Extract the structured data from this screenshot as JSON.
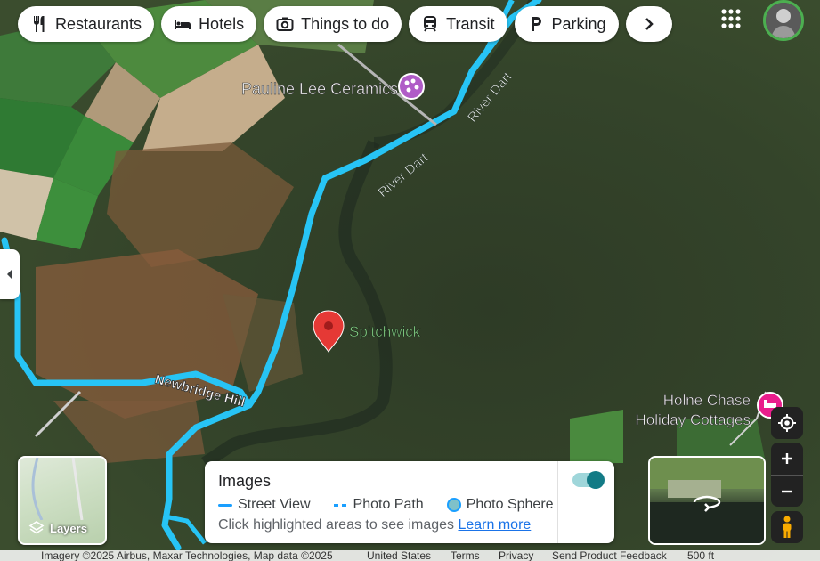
{
  "chips": [
    {
      "label": "Restaurants",
      "icon": "fork-knife-icon"
    },
    {
      "label": "Hotels",
      "icon": "bed-icon"
    },
    {
      "label": "Things to do",
      "icon": "camera-icon"
    },
    {
      "label": "Transit",
      "icon": "train-icon"
    },
    {
      "label": "Parking",
      "icon": "parking-icon"
    }
  ],
  "map": {
    "places": {
      "pauline_lee": "Pauline Lee Ceramics",
      "spitchwick": "Spitchwick",
      "holne_chase_line1": "Holne Chase",
      "holne_chase_line2": "Holiday Cottages"
    },
    "roads": {
      "river_dart_1": "River Dart",
      "river_dart_2": "River Dart",
      "newbridge_hill": "Newbridge Hill"
    }
  },
  "layers": {
    "label": "Layers"
  },
  "images_panel": {
    "title": "Images",
    "street_view": "Street View",
    "photo_path": "Photo Path",
    "photo_sphere": "Photo Sphere",
    "hint": "Click highlighted areas to see images",
    "learn_more": "Learn more",
    "toggle_on": true
  },
  "footer": {
    "imagery": "Imagery ©2025 Airbus, Maxar Technologies, Map data ©2025",
    "country": "United States",
    "terms": "Terms",
    "privacy": "Privacy",
    "feedback": "Send Product Feedback",
    "scale": "500 ft"
  },
  "colors": {
    "route": "#27c4f5",
    "pin": "#e53935",
    "poi_purple": "#b05cc7",
    "poi_pink": "#e91e8c"
  }
}
